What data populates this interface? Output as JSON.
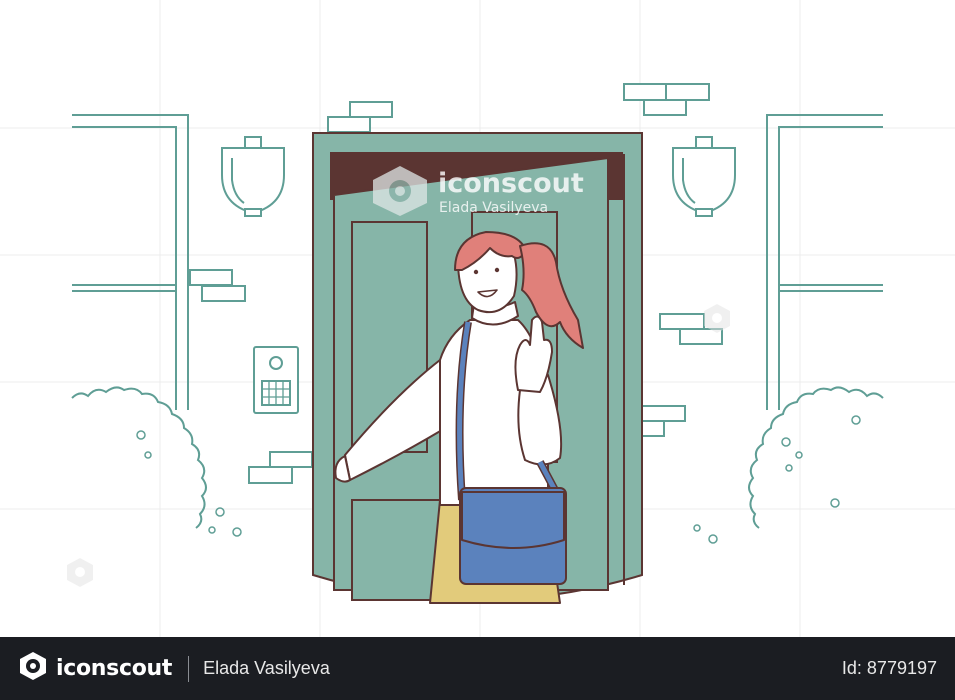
{
  "watermark": {
    "brand": "iconscout",
    "author": "Elada Vasilyeva"
  },
  "footer": {
    "brand": "iconscout",
    "author": "Elada Vasilyeva",
    "asset_id": "Id: 8779197"
  },
  "colors": {
    "line": "#5f9e95",
    "door": "#86b5a8",
    "outline": "#5b3532",
    "hair": "#e0807a",
    "bag": "#5b82bd",
    "skirt": "#e2cb7b",
    "footer_bg": "#1b1d22"
  }
}
